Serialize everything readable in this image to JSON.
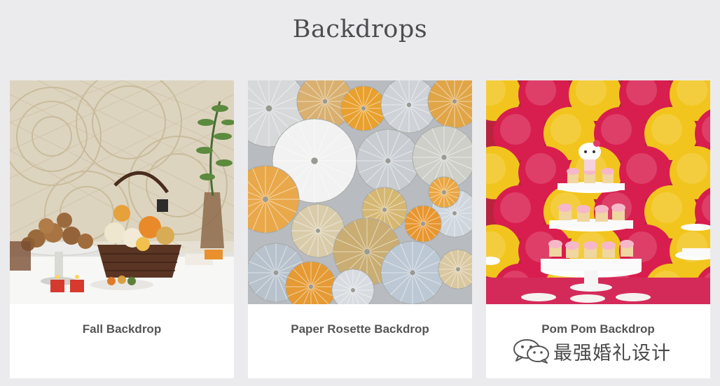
{
  "page": {
    "title": "Backdrops"
  },
  "cards": [
    {
      "title": "Fall Backdrop",
      "image_subject": "fall-backdrop-photo"
    },
    {
      "title": "Paper Rosette Backdrop",
      "image_subject": "paper-rosette-backdrop-photo"
    },
    {
      "title": "Pom Pom Backdrop",
      "image_subject": "pom-pom-backdrop-photo"
    }
  ],
  "watermark": {
    "icon": "wechat-icon",
    "text": "最强婚礼设计"
  },
  "colors": {
    "background": "#ebebed",
    "card": "#ffffff",
    "title_text": "#4c4c52",
    "card_text": "#555555"
  }
}
